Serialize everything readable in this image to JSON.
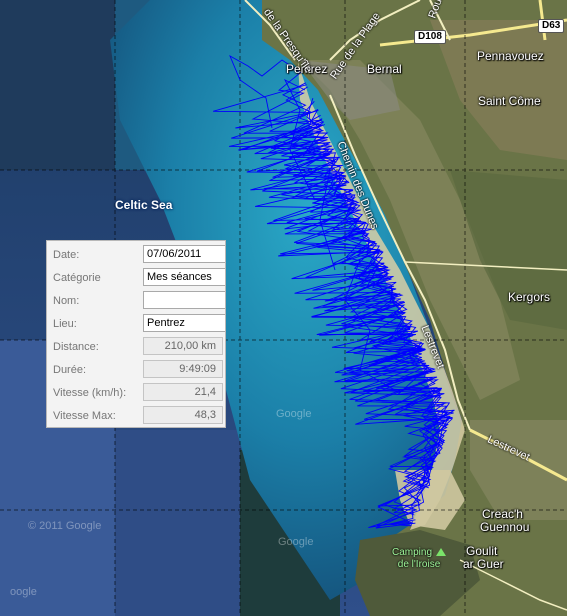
{
  "map": {
    "places": {
      "pentrez": "Pentrez",
      "bernal": "Bernal",
      "pennavouez": "Pennavouez",
      "saint_come": "Saint Côme",
      "kergors": "Kergors",
      "creach_guennou_1": "Creac'h",
      "creach_guennou_2": "Guennou",
      "goulit_1": "Goulit",
      "goulit_2": "ar Guer",
      "celtic_sea": "Celtic Sea",
      "camping_1": "Camping",
      "camping_2": "de l'Iroise"
    },
    "roads": {
      "d63": "D63",
      "d108": "D108",
      "presqu_ile": "de la Presqu'île",
      "plage": "Rue de la Plage",
      "route": "Route",
      "dunes": "Chemin des Dunes",
      "lestrevet_1": "Lestrevet",
      "lestrevet_2": "Lestrevet"
    },
    "watermarks": {
      "w1": "© 2011 Google",
      "w2": "Google",
      "w3": "Google",
      "w4": "oogle"
    },
    "colors": {
      "track": "#0000ff",
      "sea": "#1f9dbd",
      "land": "#6b7748"
    }
  },
  "panel": {
    "fields": [
      {
        "label": "Date:",
        "value": "07/06/2011",
        "readonly": false
      },
      {
        "label": "Catégorie",
        "value": "Mes séances",
        "readonly": false
      },
      {
        "label": "Nom:",
        "value": "",
        "readonly": false
      },
      {
        "label": "Lieu:",
        "value": "Pentrez",
        "readonly": false
      },
      {
        "label": "Distance:",
        "value": "210,00 km",
        "readonly": true
      },
      {
        "label": "Durée:",
        "value": "9:49:09",
        "readonly": true
      },
      {
        "label": "Vitesse (km/h):",
        "value": "21,4",
        "readonly": true
      },
      {
        "label": "Vitesse Max:",
        "value": "48,3",
        "readonly": true
      }
    ]
  }
}
